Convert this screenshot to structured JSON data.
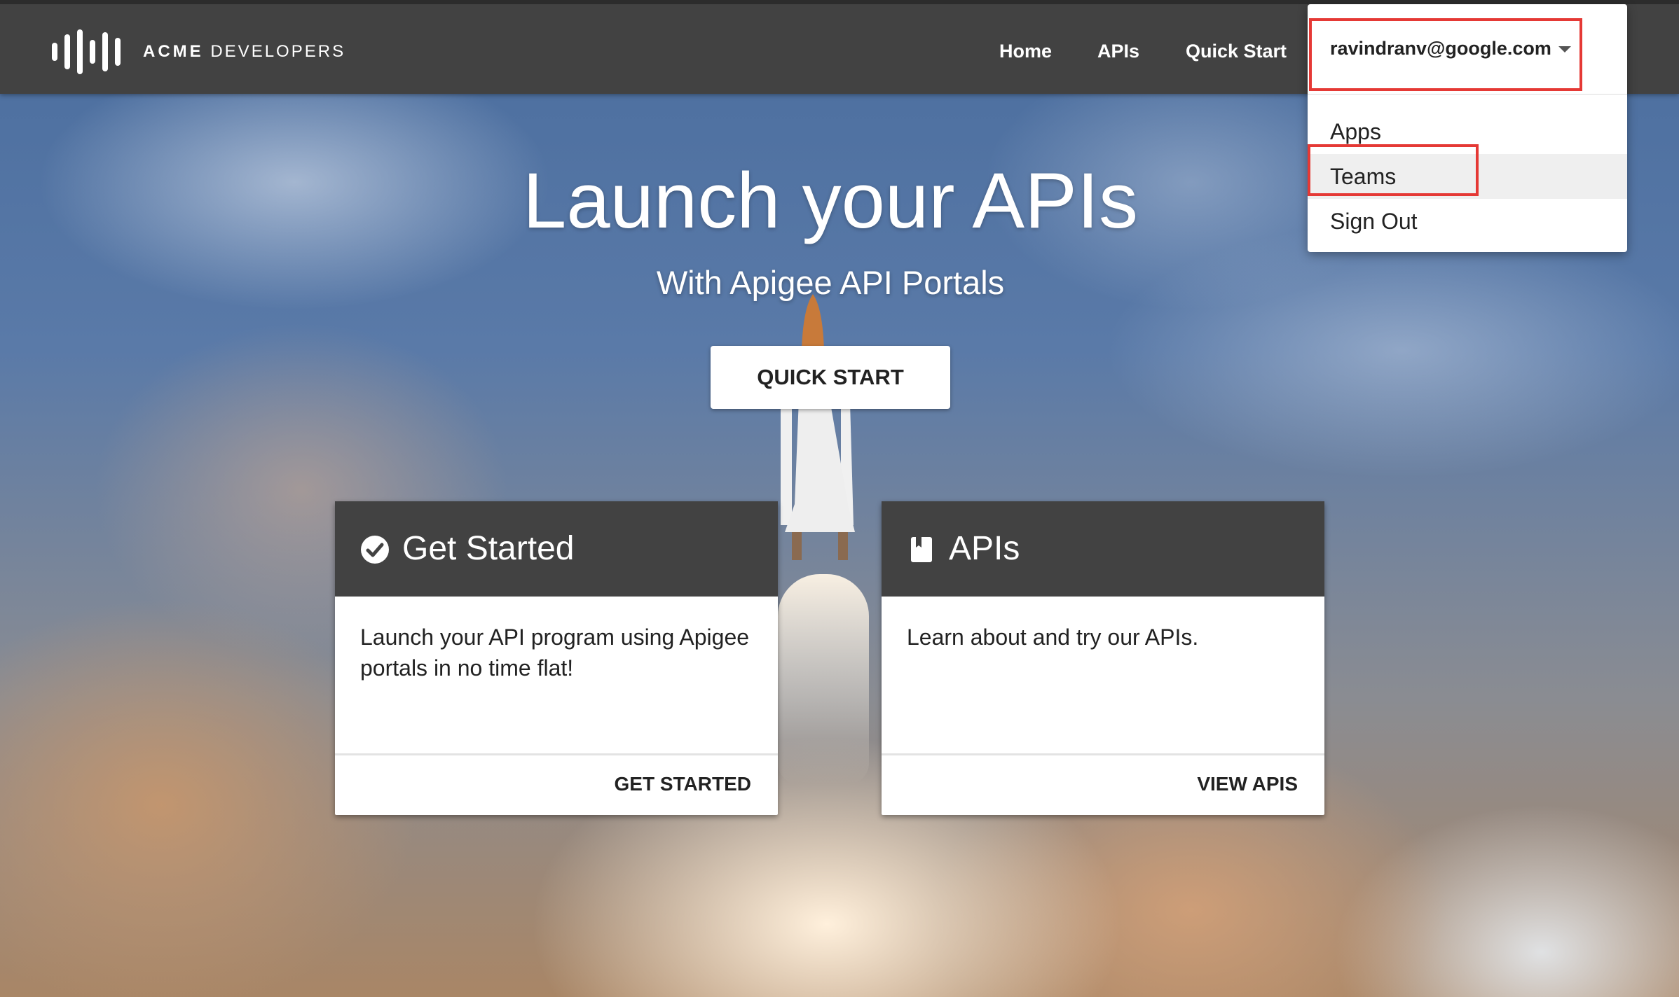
{
  "brand": {
    "bold": "ACME",
    "rest": "DEVELOPERS"
  },
  "nav": {
    "home": "Home",
    "apis": "APIs",
    "quick_start": "Quick Start"
  },
  "account": {
    "email": "ravindranv@google.com",
    "menu": [
      {
        "label": "Apps"
      },
      {
        "label": "Teams"
      },
      {
        "label": "Sign Out"
      }
    ]
  },
  "hero": {
    "title": "Launch your APIs",
    "subtitle": "With Apigee API Portals",
    "cta": "QUICK START"
  },
  "cards": [
    {
      "icon": "check-circle-icon",
      "title": "Get Started",
      "body": "Launch your API program using Apigee portals in no time flat!",
      "action": "GET STARTED"
    },
    {
      "icon": "book-icon",
      "title": "APIs",
      "body": "Learn about and try our APIs.",
      "action": "VIEW APIS"
    }
  ],
  "colors": {
    "topbar": "#424242",
    "highlight": "#e53935",
    "card_header": "#424242"
  }
}
